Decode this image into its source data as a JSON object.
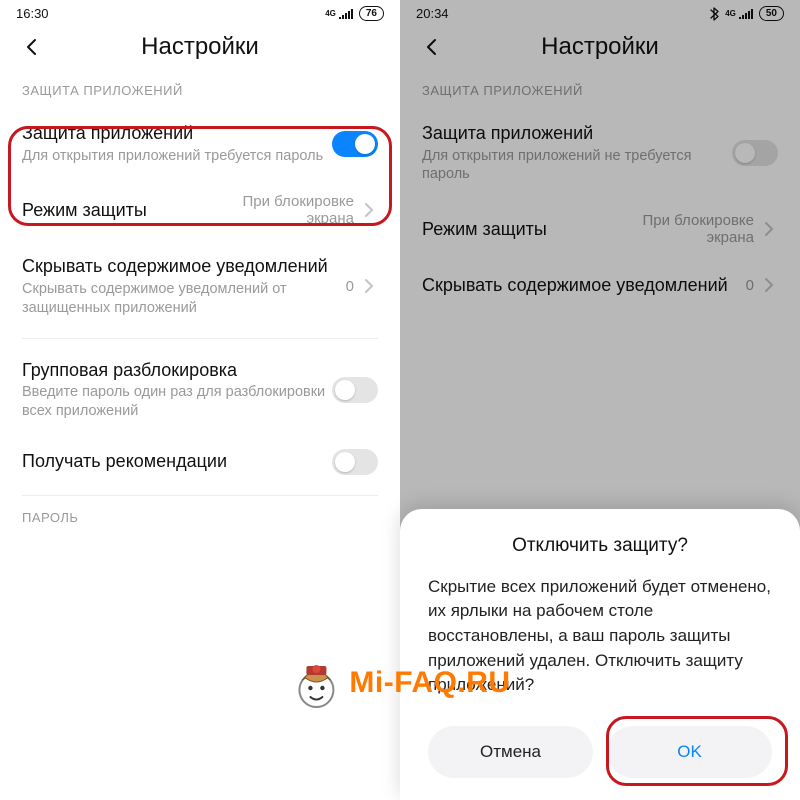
{
  "left": {
    "status": {
      "time": "16:30",
      "net": "4G",
      "battery": "76"
    },
    "title": "Настройки",
    "section": "ЗАЩИТА ПРИЛОЖЕНИЙ",
    "toggle1": {
      "title": "Защита приложений",
      "sub": "Для открытия приложений требуется пароль"
    },
    "mode": {
      "title": "Режим защиты",
      "value": "При блокировке экрана"
    },
    "hide": {
      "title": "Скрывать содержимое уведомлений",
      "sub": "Скрывать содержимое уведомлений от защищенных приложений",
      "value": "0"
    },
    "group": {
      "title": "Групповая разблокировка",
      "sub": "Введите пароль один раз для разблокировки всех приложений"
    },
    "recs": {
      "title": "Получать рекомендации"
    },
    "pwd_section": "ПАРОЛЬ"
  },
  "right": {
    "status": {
      "time": "20:34",
      "net": "4G",
      "battery": "50"
    },
    "title": "Настройки",
    "section": "ЗАЩИТА ПРИЛОЖЕНИЙ",
    "toggle1": {
      "title": "Защита приложений",
      "sub": "Для открытия приложений не требуется пароль"
    },
    "mode": {
      "title": "Режим защиты",
      "value": "При блокировке экрана"
    },
    "hide": {
      "title": "Скрывать содержимое уведомлений",
      "value": "0"
    },
    "dialog": {
      "title": "Отключить защиту?",
      "body": "Скрытие всех приложений будет отменено, их ярлыки на рабочем столе восстановлены, а ваш пароль защиты приложений удален. Отключить защиту приложений?",
      "cancel": "Отмена",
      "ok": "OK"
    }
  },
  "watermark": "Mi-FAQ.RU"
}
